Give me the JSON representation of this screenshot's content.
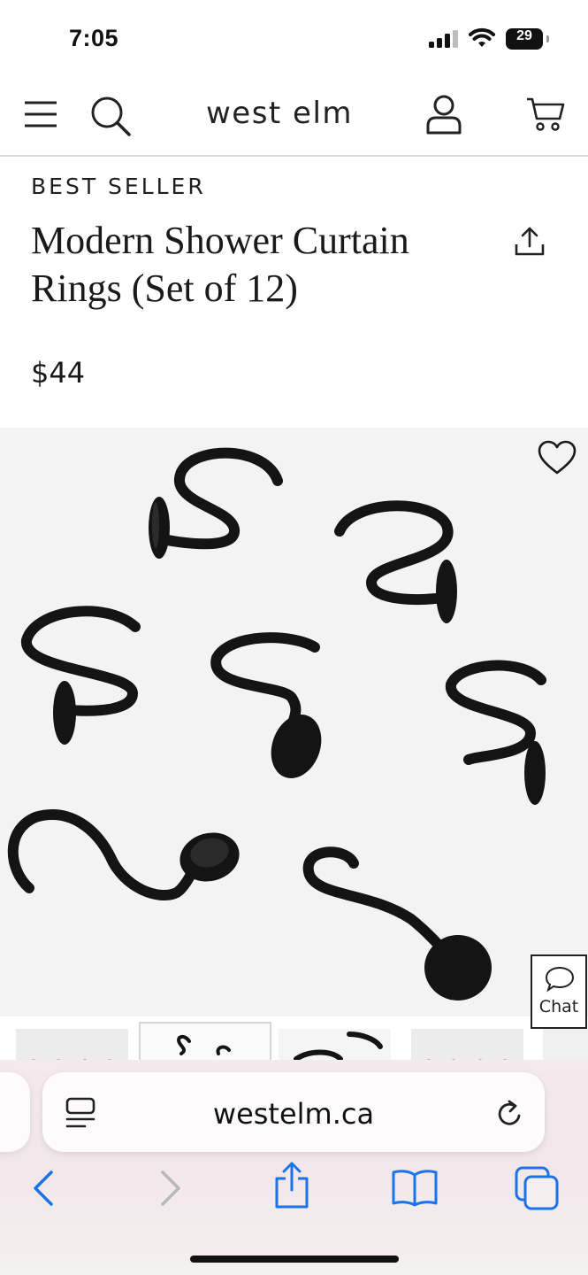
{
  "status": {
    "time": "7:05",
    "battery": "29"
  },
  "header": {
    "logo": "west elm"
  },
  "product": {
    "badge": "BEST SELLER",
    "title": "Modern Shower Curtain Rings (Set of 12)",
    "price": "$44"
  },
  "chat": {
    "label": "Chat"
  },
  "browser": {
    "url": "westelm.ca"
  },
  "colors": {
    "accent_blue": "#1a73e8",
    "hook_black": "#141414"
  }
}
